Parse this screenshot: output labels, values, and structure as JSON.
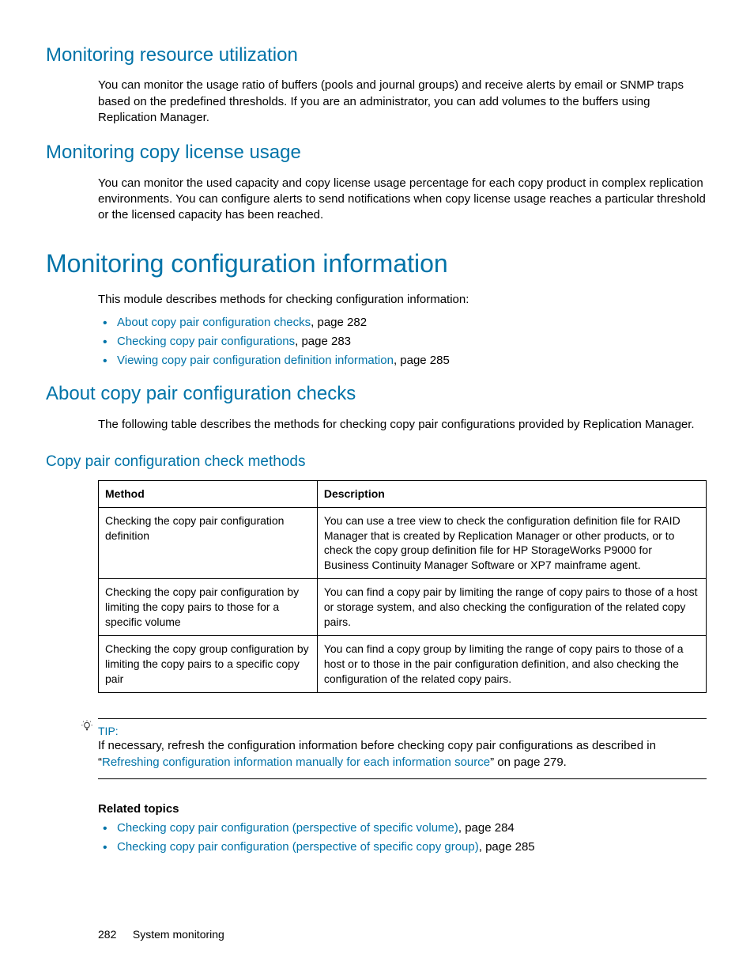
{
  "sections": {
    "resource": {
      "title": "Monitoring resource utilization",
      "body": "You can monitor the usage ratio of buffers (pools and journal groups) and receive alerts by email or SNMP traps based on the predefined thresholds. If you are an administrator, you can add volumes to the buffers using Replication Manager."
    },
    "license": {
      "title": "Monitoring copy license usage",
      "body": "You can monitor the used capacity and copy license usage percentage for each copy product in complex replication environments. You can configure alerts to send notifications when copy license usage reaches a particular threshold or the licensed capacity has been reached."
    },
    "config": {
      "title": "Monitoring configuration information",
      "intro": "This module describes methods for checking configuration information:",
      "links": [
        {
          "label": "About copy pair configuration checks",
          "suffix": ", page 282"
        },
        {
          "label": "Checking copy pair configurations",
          "suffix": ", page 283"
        },
        {
          "label": "Viewing copy pair configuration definition information",
          "suffix": ", page 285"
        }
      ]
    },
    "about": {
      "title": "About copy pair configuration checks",
      "body": "The following table describes the methods for checking copy pair configurations provided by Replication Manager."
    },
    "methods": {
      "title": "Copy pair configuration check methods",
      "headers": {
        "c0": "Method",
        "c1": "Description"
      },
      "rows": [
        {
          "method": "Checking the copy pair configuration definition",
          "desc": "You can use a tree view to check the configuration definition file for RAID Manager that is created by Replication Manager or other products, or to check the copy group definition file for HP StorageWorks P9000 for Business Continuity Manager Software or XP7 mainframe agent."
        },
        {
          "method": "Checking the copy pair configuration by limiting the copy pairs to those for a specific volume",
          "desc": "You can find a copy pair by limiting the range of copy pairs to those of a host or storage system, and also checking the configuration of the related copy pairs."
        },
        {
          "method": "Checking the copy group configuration by limiting the copy pairs to a specific copy pair",
          "desc": "You can find a copy group by limiting the range of copy pairs to those of a host or to those in the pair configuration definition, and also checking the configuration of the related copy pairs."
        }
      ]
    },
    "tip": {
      "label": "TIP:",
      "pre": "If necessary, refresh the configuration information before checking copy pair configurations as described in “",
      "link": "Refreshing configuration information manually for each information source",
      "post": "” on page 279."
    },
    "related": {
      "title": "Related topics",
      "items": [
        {
          "label": "Checking copy pair configuration (perspective of specific volume)",
          "suffix": ", page 284"
        },
        {
          "label": "Checking copy pair configuration (perspective of specific copy group)",
          "suffix": ", page 285"
        }
      ]
    }
  },
  "footer": {
    "page": "282",
    "section": "System monitoring"
  }
}
